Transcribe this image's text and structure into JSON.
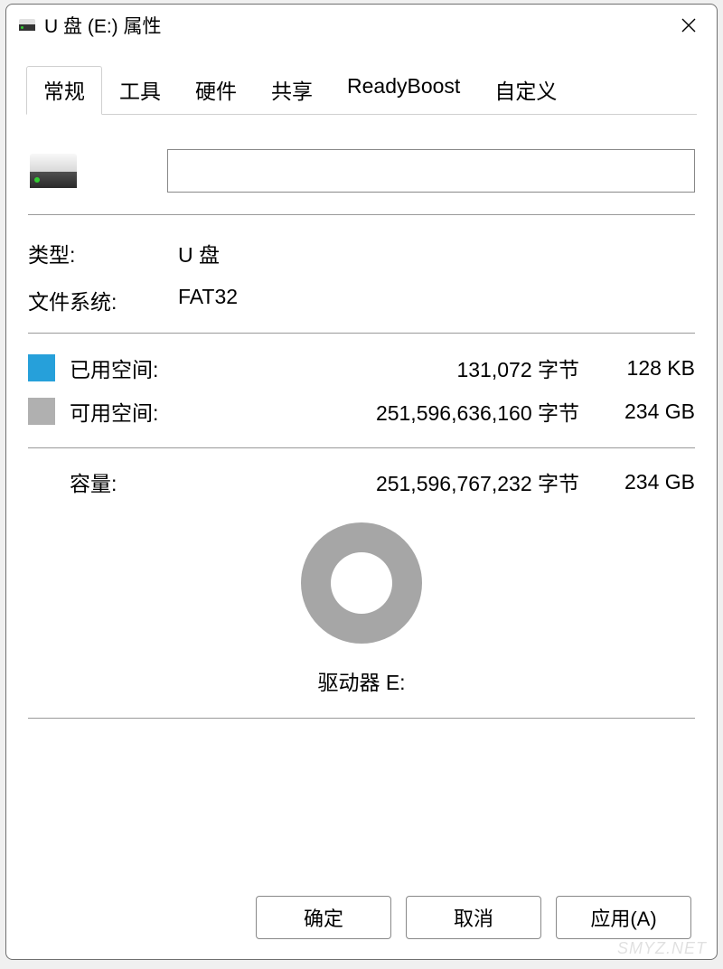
{
  "window": {
    "title": "U 盘 (E:) 属性"
  },
  "tabs": [
    {
      "label": "常规",
      "active": true
    },
    {
      "label": "工具",
      "active": false
    },
    {
      "label": "硬件",
      "active": false
    },
    {
      "label": "共享",
      "active": false
    },
    {
      "label": "ReadyBoost",
      "active": false
    },
    {
      "label": "自定义",
      "active": false
    }
  ],
  "general": {
    "name_value": "",
    "type_label": "类型:",
    "type_value": "U 盘",
    "fs_label": "文件系统:",
    "fs_value": "FAT32",
    "used_label": "已用空间:",
    "used_bytes": "131,072 字节",
    "used_human": "128 KB",
    "free_label": "可用空间:",
    "free_bytes": "251,596,636,160 字节",
    "free_human": "234 GB",
    "capacity_label": "容量:",
    "capacity_bytes": "251,596,767,232 字节",
    "capacity_human": "234 GB",
    "drive_letter_label": "驱动器 E:"
  },
  "colors": {
    "used": "#26a0da",
    "free": "#b0b0b0"
  },
  "buttons": {
    "ok": "确定",
    "cancel": "取消",
    "apply": "应用(A)"
  },
  "watermark": "SMYZ.NET"
}
